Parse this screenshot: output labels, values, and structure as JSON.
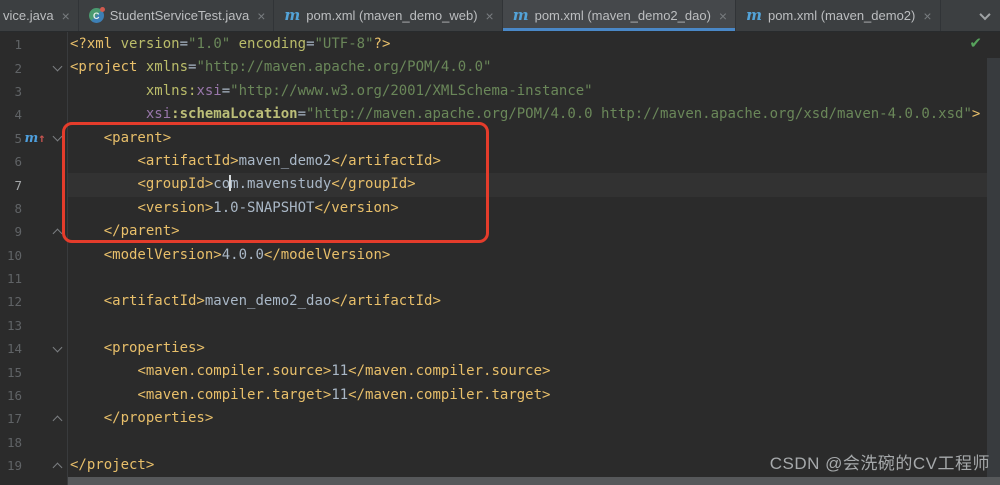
{
  "tab_bar": {
    "tabs": [
      {
        "label": "vice.java",
        "icon": "none",
        "active": false,
        "clipped": true
      },
      {
        "label": "StudentServiceTest.java",
        "icon": "java-test-class",
        "active": false,
        "clipped": false
      },
      {
        "label": "pom.xml (maven_demo_web)",
        "icon": "maven",
        "active": false,
        "clipped": false
      },
      {
        "label": "pom.xml (maven_demo2_dao)",
        "icon": "maven",
        "active": true,
        "clipped": false
      },
      {
        "label": "pom.xml (maven_demo2)",
        "icon": "maven",
        "active": false,
        "clipped": false
      }
    ],
    "close_glyph": "×",
    "overflow_icon": "chevron-down-icon"
  },
  "editor": {
    "current_line": 7,
    "inspection_status_icon": "green-checkmark",
    "inspection_glyph": "✔",
    "annotation": {
      "type": "red-box",
      "covers_lines": "5-9"
    },
    "gutter_icon_line5": "maven-parent-pom-up",
    "lines": [
      {
        "n": 1,
        "fold": null,
        "icon": null,
        "segs": [
          [
            "tag",
            "<?xml "
          ],
          [
            "attr",
            "version"
          ],
          [
            "plain",
            "="
          ],
          [
            "string",
            "\"1.0\""
          ],
          [
            "plain",
            " "
          ],
          [
            "attr",
            "encoding"
          ],
          [
            "plain",
            "="
          ],
          [
            "string",
            "\"UTF-8\""
          ],
          [
            "tag",
            "?>"
          ]
        ]
      },
      {
        "n": 2,
        "fold": "down",
        "icon": null,
        "segs": [
          [
            "tag",
            "<project "
          ],
          [
            "attr",
            "xmlns"
          ],
          [
            "plain",
            "="
          ],
          [
            "string",
            "\"http://maven.apache.org/POM/4.0.0\""
          ]
        ]
      },
      {
        "n": 3,
        "fold": null,
        "icon": null,
        "segs": [
          [
            "plain",
            "         "
          ],
          [
            "attr",
            "xmlns:"
          ],
          [
            "prefix",
            "xsi"
          ],
          [
            "plain",
            "="
          ],
          [
            "string",
            "\"http://www.w3.org/2001/XMLSchema-instance\""
          ]
        ]
      },
      {
        "n": 4,
        "fold": null,
        "icon": null,
        "segs": [
          [
            "plain",
            "         "
          ],
          [
            "prefix",
            "xsi"
          ],
          [
            "attr-bold",
            ":schemaLocation"
          ],
          [
            "plain",
            "="
          ],
          [
            "string",
            "\"http://maven.apache.org/POM/4.0.0 http://maven.apache.org/xsd/maven-4.0.0.xsd\""
          ],
          [
            "tag",
            ">"
          ]
        ]
      },
      {
        "n": 5,
        "fold": "down",
        "icon": "maven-up",
        "segs": [
          [
            "plain",
            "    "
          ],
          [
            "tag",
            "<parent>"
          ]
        ]
      },
      {
        "n": 6,
        "fold": null,
        "icon": null,
        "segs": [
          [
            "plain",
            "        "
          ],
          [
            "tag",
            "<artifactId>"
          ],
          [
            "text",
            "maven_demo2"
          ],
          [
            "tag",
            "</artifactId>"
          ]
        ]
      },
      {
        "n": 7,
        "fold": null,
        "icon": null,
        "segs": [
          [
            "plain",
            "        "
          ],
          [
            "tag",
            "<groupId>"
          ],
          [
            "text",
            "co"
          ],
          [
            "caret",
            ""
          ],
          [
            "text",
            "m.mavenstudy"
          ],
          [
            "tag",
            "</groupId>"
          ]
        ]
      },
      {
        "n": 8,
        "fold": null,
        "icon": null,
        "segs": [
          [
            "plain",
            "        "
          ],
          [
            "tag",
            "<version>"
          ],
          [
            "text",
            "1.0-SNAPSHOT"
          ],
          [
            "tag",
            "</version>"
          ]
        ]
      },
      {
        "n": 9,
        "fold": "up",
        "icon": null,
        "segs": [
          [
            "plain",
            "    "
          ],
          [
            "tag",
            "</parent>"
          ]
        ]
      },
      {
        "n": 10,
        "fold": null,
        "icon": null,
        "segs": [
          [
            "plain",
            "    "
          ],
          [
            "tag",
            "<modelVersion>"
          ],
          [
            "text",
            "4.0.0"
          ],
          [
            "tag",
            "</modelVersion>"
          ]
        ]
      },
      {
        "n": 11,
        "fold": null,
        "icon": null,
        "segs": []
      },
      {
        "n": 12,
        "fold": null,
        "icon": null,
        "segs": [
          [
            "plain",
            "    "
          ],
          [
            "tag",
            "<artifactId>"
          ],
          [
            "text",
            "maven_demo2_dao"
          ],
          [
            "tag",
            "</artifactId>"
          ]
        ]
      },
      {
        "n": 13,
        "fold": null,
        "icon": null,
        "segs": []
      },
      {
        "n": 14,
        "fold": "down",
        "icon": null,
        "segs": [
          [
            "plain",
            "    "
          ],
          [
            "tag",
            "<properties>"
          ]
        ]
      },
      {
        "n": 15,
        "fold": null,
        "icon": null,
        "segs": [
          [
            "plain",
            "        "
          ],
          [
            "tag",
            "<maven.compiler.source>"
          ],
          [
            "text",
            "11"
          ],
          [
            "tag",
            "</maven.compiler.source>"
          ]
        ]
      },
      {
        "n": 16,
        "fold": null,
        "icon": null,
        "segs": [
          [
            "plain",
            "        "
          ],
          [
            "tag",
            "<maven.compiler.target>"
          ],
          [
            "text",
            "11"
          ],
          [
            "tag",
            "</maven.compiler.target>"
          ]
        ]
      },
      {
        "n": 17,
        "fold": "up",
        "icon": null,
        "segs": [
          [
            "plain",
            "    "
          ],
          [
            "tag",
            "</properties>"
          ]
        ]
      },
      {
        "n": 18,
        "fold": null,
        "icon": null,
        "segs": []
      },
      {
        "n": 19,
        "fold": "up",
        "icon": null,
        "segs": [
          [
            "tag",
            "</project>"
          ]
        ]
      }
    ]
  },
  "watermark": "CSDN @会洗碗的CV工程师",
  "colors": {
    "editor_bg": "#2b2b2b",
    "tab_bar_bg": "#3c3f41",
    "active_tab_bg": "#45484b",
    "active_tab_underline": "#4a88c7",
    "annotation_red": "#e43c2b",
    "xml_tag": "#e8bf6a",
    "xml_attr": "#babc6a",
    "xml_ns_prefix": "#9876aa",
    "xml_string": "#6a8759",
    "xml_text": "#a9b7c6",
    "line_number": "#606366",
    "maven_icon_blue": "#53a3d8",
    "inspection_ok_green": "#57a35c"
  }
}
